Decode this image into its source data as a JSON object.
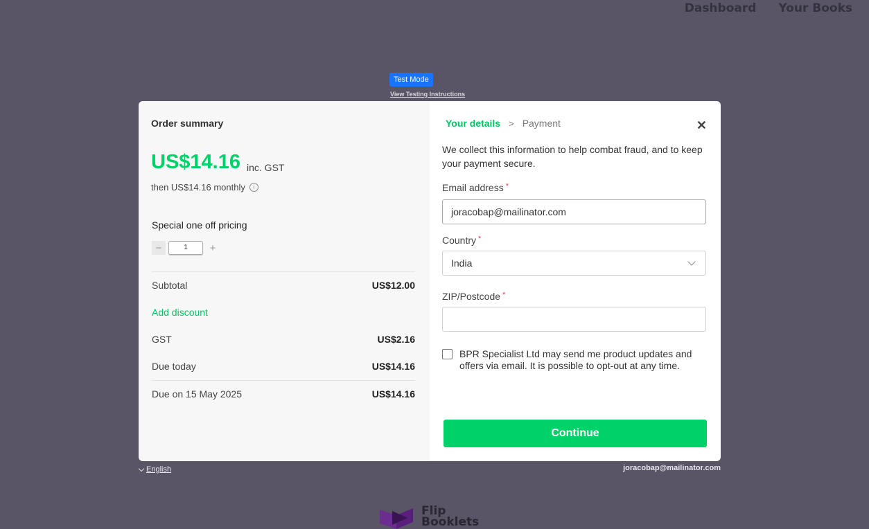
{
  "nav": {
    "dashboard": "Dashboard",
    "your_books": "Your Books"
  },
  "test_mode": {
    "badge": "Test Mode",
    "link": "View Testing Instructions"
  },
  "order": {
    "title": "Order summary",
    "price": "US$14.16",
    "price_suffix": "inc. GST",
    "then_text": "then US$14.16 monthly",
    "pricing_label": "Special one off pricing",
    "quantity": "1",
    "subtotal_label": "Subtotal",
    "subtotal_value": "US$12.00",
    "add_discount": "Add discount",
    "gst_label": "GST",
    "gst_value": "US$2.16",
    "due_today_label": "Due today",
    "due_today_value": "US$14.16",
    "due_on_label": "Due on 15 May 2025",
    "due_on_value": "US$14.16"
  },
  "details": {
    "step_active": "Your details",
    "step_next": "Payment",
    "intro": "We collect this information to help combat fraud, and to keep your payment secure.",
    "email_label": "Email address",
    "email_value": "joracobap@mailinator.com",
    "country_label": "Country",
    "country_value": "India",
    "zip_label": "ZIP/Postcode",
    "zip_value": "",
    "required_mark": "*",
    "consent": "BPR Specialist Ltd may send me product updates and offers via email. It is possible to opt-out at any time.",
    "continue": "Continue"
  },
  "footer": {
    "language": "English",
    "email": "joracobap@mailinator.com",
    "logo_line1": "Flip",
    "logo_line2": "Booklets"
  },
  "colors": {
    "accent": "#00d26a",
    "overlay": "#595566",
    "test_badge": "#1a73ff"
  }
}
